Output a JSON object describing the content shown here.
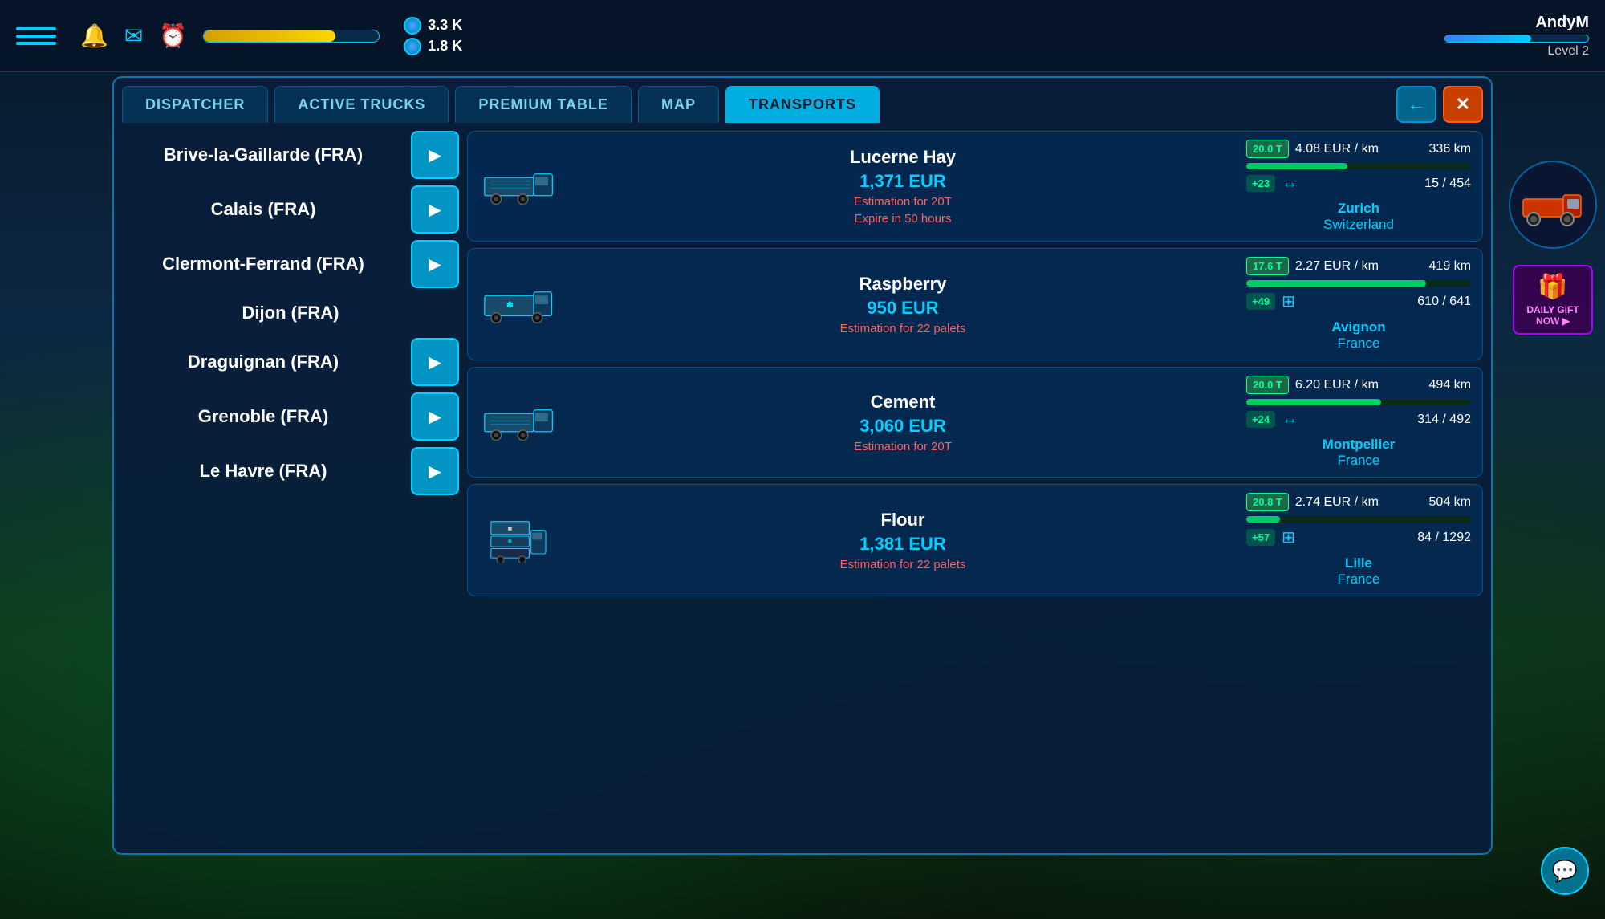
{
  "topbar": {
    "currency1_label": "3.3 K",
    "currency2_label": "1.8 K",
    "progress_pct": 75,
    "user_name": "AndyM",
    "level_label": "Level 2",
    "level_pct": 60
  },
  "tabs": [
    {
      "id": "dispatcher",
      "label": "DISPATCHER",
      "active": false
    },
    {
      "id": "active_trucks",
      "label": "ACTIVE TRUCKS",
      "active": false
    },
    {
      "id": "premium_table",
      "label": "PREMIUM TABLE",
      "active": false
    },
    {
      "id": "map",
      "label": "MAP",
      "active": false
    },
    {
      "id": "transports",
      "label": "TRANSPORTS",
      "active": true
    }
  ],
  "cities": [
    {
      "name": "Brive-la-Gaillarde (FRA)",
      "has_arrow": true
    },
    {
      "name": "Calais (FRA)",
      "has_arrow": true
    },
    {
      "name": "Clermont-Ferrand (FRA)",
      "has_arrow": true
    },
    {
      "name": "Dijon (FRA)",
      "has_arrow": false
    },
    {
      "name": "Draguignan (FRA)",
      "has_arrow": true
    },
    {
      "name": "Grenoble (FRA)",
      "has_arrow": true
    },
    {
      "name": "Le Havre (FRA)",
      "has_arrow": true
    }
  ],
  "transports": [
    {
      "cargo": "Lucerne Hay",
      "price": "1,371 EUR",
      "estimation": "Estimation for 20T",
      "expire": "Expire in 50 hours",
      "weight": "20.0 T",
      "rate": "4.08 EUR / km",
      "distance": "336 km",
      "progress_pct": 45,
      "plus": "+23",
      "capacity_type": "axle",
      "capacity": "15 / 454",
      "dest_city": "Zurich",
      "dest_country": "Switzerland",
      "truck_type": "flatbed"
    },
    {
      "cargo": "Raspberry",
      "price": "950 EUR",
      "estimation": "Estimation for 22 palets",
      "expire": "",
      "weight": "17.6 T",
      "rate": "2.27 EUR / km",
      "distance": "419 km",
      "progress_pct": 80,
      "plus": "+49",
      "capacity_type": "solar",
      "capacity": "610 / 641",
      "dest_city": "Avignon",
      "dest_country": "France",
      "truck_type": "refrigerated"
    },
    {
      "cargo": "Cement",
      "price": "3,060 EUR",
      "estimation": "Estimation for 20T",
      "expire": "",
      "weight": "20.0 T",
      "rate": "6.20 EUR / km",
      "distance": "494 km",
      "progress_pct": 60,
      "plus": "+24",
      "capacity_type": "axle",
      "capacity": "314 / 492",
      "dest_city": "Montpellier",
      "dest_country": "France",
      "truck_type": "flatbed"
    },
    {
      "cargo": "Flour",
      "price": "1,381 EUR",
      "estimation": "Estimation for 22 palets",
      "expire": "",
      "weight": "20.8 T",
      "rate": "2.74 EUR / km",
      "distance": "504 km",
      "progress_pct": 15,
      "plus": "+57",
      "capacity_type": "solar",
      "capacity": "84 / 1292",
      "dest_city": "Lille",
      "dest_country": "France",
      "truck_type": "multi"
    }
  ],
  "daily_gift": {
    "label": "DAILY GIFT NOW"
  },
  "back_label": "←",
  "close_label": "✕"
}
